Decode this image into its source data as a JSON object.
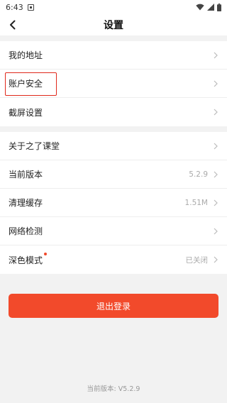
{
  "status_bar": {
    "time": "6:43",
    "icons": [
      "notification-icon",
      "wifi-icon",
      "signal-icon",
      "battery-icon"
    ]
  },
  "header": {
    "title": "设置",
    "back_icon": "chevron-left-icon"
  },
  "group1": [
    {
      "label": "我的地址"
    },
    {
      "label": "账户安全"
    },
    {
      "label": "截屏设置"
    }
  ],
  "group2": [
    {
      "label": "关于之了课堂"
    },
    {
      "label": "当前版本",
      "value": "5.2.9"
    },
    {
      "label": "清理缓存",
      "value": "1.51M"
    },
    {
      "label": "网络检测"
    },
    {
      "label": "深色模式",
      "value": "已关闭"
    }
  ],
  "logout_label": "退出登录",
  "footer_version": "当前版本: V5.2.9",
  "colors": {
    "accent": "#f24a2b",
    "highlight": "#e0281b",
    "background": "#f2f2f2"
  }
}
